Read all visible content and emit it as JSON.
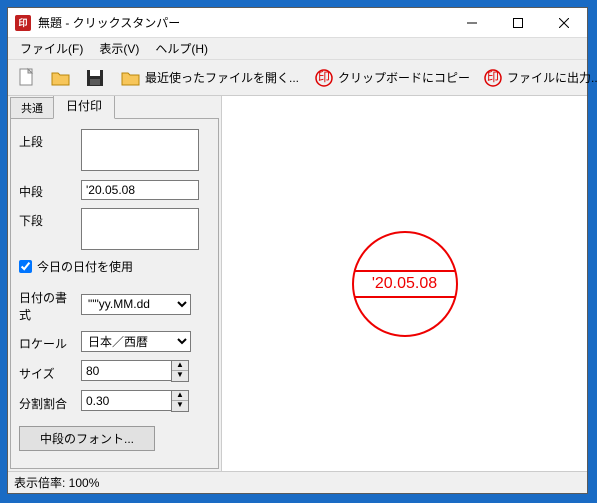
{
  "title": "無題 - クリックスタンパー",
  "menu": {
    "file": "ファイル(F)",
    "view": "表示(V)",
    "help": "ヘルプ(H)"
  },
  "toolbar": {
    "recent": "最近使ったファイルを開く...",
    "clipboard": "クリップボードにコピー",
    "output": "ファイルに出力..."
  },
  "tabs": {
    "common": "共通",
    "datestamp": "日付印"
  },
  "form": {
    "top_label": "上段",
    "mid_label": "中段",
    "bot_label": "下段",
    "top_value": "",
    "mid_value": "'20.05.08",
    "bot_value": "",
    "use_today": "今日の日付を使用",
    "fmt_label": "日付の書式",
    "fmt_value": "\"'\"yy.MM.dd",
    "locale_label": "ロケール",
    "locale_value": "日本／西暦",
    "size_label": "サイズ",
    "size_value": "80",
    "ratio_label": "分割割合",
    "ratio_value": "0.30",
    "font_btn": "中段のフォント..."
  },
  "stamp": {
    "top": "",
    "mid": "'20.05.08",
    "bot": ""
  },
  "status": {
    "zoom": "表示倍率: 100%"
  },
  "colors": {
    "stamp": "#ee0000"
  }
}
